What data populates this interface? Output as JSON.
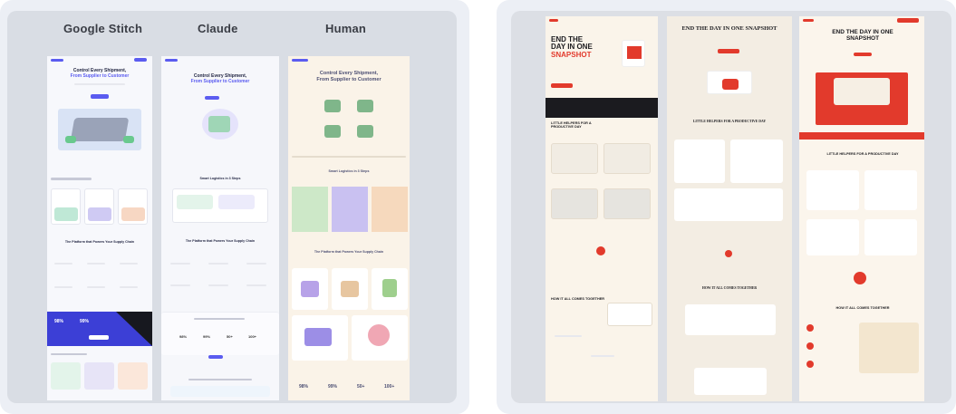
{
  "left_panel": {
    "columns": [
      {
        "title": "Google Stitch"
      },
      {
        "title": "Claude"
      },
      {
        "title": "Human"
      }
    ],
    "headline_primary": "Control Every Shipment,",
    "headline_secondary": "From Supplier to Customer",
    "section_smart": "Smart Logistics in 3 Steps",
    "section_power": "The Platform that Powers Your Supply Chain",
    "stats": [
      "98%",
      "99%",
      "50+",
      "100+"
    ]
  },
  "right_panel": {
    "headline": "END THE DAY IN ONE SNAPSHOT",
    "headline_lines": [
      "END THE",
      "DAY IN ONE",
      "SNAPSHOT"
    ],
    "section_little": "LITTLE HELPERS FOR A PRODUCTIVE DAY",
    "section_together": "HOW IT ALL COMES TOGETHER"
  },
  "colors": {
    "accent_purple": "#5b5cf0",
    "accent_red": "#e23a2c",
    "cream": "#faf4ea"
  }
}
